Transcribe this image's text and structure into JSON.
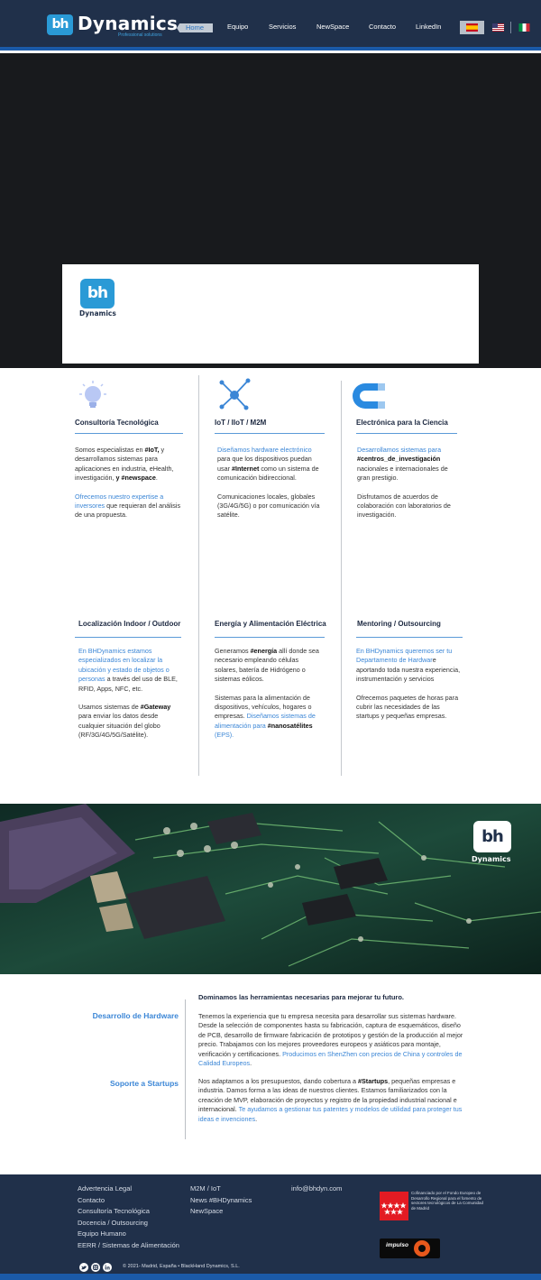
{
  "header": {
    "logo_mark": "bh",
    "logo_text": "Dynamics",
    "logo_tagline": "Professional solutions",
    "nav": [
      "Home",
      "Equipo",
      "Servicios",
      "NewSpace",
      "Contacto",
      "LinkedIn"
    ],
    "languages": [
      "es",
      "en",
      "it"
    ]
  },
  "hero": {
    "logo_mark": "bh",
    "logo_text": "Dynamics"
  },
  "services": [
    {
      "title": "Consultoría Tecnológica",
      "icon": "lightbulb-icon",
      "p1_a": "Somos especialistas en ",
      "p1_b": "#IoT,",
      "p1_c": " y desarrollamos sistemas para aplicaciones en industria, eHealth, investigación,  ",
      "p1_d": "y #newspace",
      "p1_e": ".",
      "p2_a": "Ofrecemos nuestro expertise a inversores",
      "p2_b": " que requieran del análisis de una propuesta."
    },
    {
      "title": "IoT / IIoT / M2M",
      "icon": "network-nodes-icon",
      "p1_a": "Diseñamos  hardware electrónico",
      "p1_b": " para que los dispositivos puedan usar ",
      "p1_c": "#Internet",
      "p1_d": " como un sistema de comunicación bidireccional.",
      "p2": "Comunicaciones locales, globales (3G/4G/5G) o por comunicación vía satélite."
    },
    {
      "title": "Electrónica para la Ciencia",
      "icon": "magnet-icon",
      "p1_a": "Desarrollamos sistemas para ",
      "p1_b": "#centros_de_investigación",
      "p1_c": " nacionales e internacionales de gran prestigio.",
      "p2": "Disfrutamos de acuerdos de colaboración con laboratorios de investigación."
    },
    {
      "title": "Localización Indoor / Outdoor",
      "p1_a": "En BHDynamics estamos especializados en localizar la ubicación y estado de objetos o personas",
      "p1_b": " a través del uso de BLE, RFID, Apps, NFC, etc.",
      "p2_a": "Usamos sistemas de ",
      "p2_b": "#Gateway",
      "p2_c": " para enviar los datos desde cualquier situación del globo (RF/3G/4G/5G/Satélite)."
    },
    {
      "title": "Energía y Alimentación Eléctrica",
      "p1_a": "Generamos ",
      "p1_b": "#energía",
      "p1_c": " allí donde sea necesario empleando células solares, batería de Hidrógeno o sistemas eólicos.",
      "p2_a": "Sistemas para la alimentación de dispositivos, vehículos, hogares o empresas. ",
      "p2_b": "Diseñamos sistemas de alimentación para ",
      "p2_c": "#nanosatélites",
      "p2_d": " (EPS)."
    },
    {
      "title": "Mentoring / Outsourcing",
      "p1_a": "En BHDynamics queremos ser tu Departamento de Hardwar",
      "p1_b": "e aportando toda nuestra experiencia, instrumentación y servicios",
      "p2": "Ofrecemos paquetes de horas para cubrir las necesidades de las startups y pequeñas empresas."
    }
  ],
  "pcb_banner": {
    "logo_mark": "bh",
    "logo_text": "Dynamics"
  },
  "tools": {
    "heading": "Dominamos las herramientas necesarias para mejorar tu futuro.",
    "hw_label": "Desarrollo de Hardware",
    "hw_text_a": "Tenemos la experiencia que tu empresa necesita para desarrollar sus sistemas hardware. Desde la selección de componentes hasta su fabricación, captura de esquemáticos, diseño de PCB, desarrollo de firmware fabricación de prototipos y gestión de la producción al mejor precio.  Trabajamos con los mejores proveedores europeos y asiáticos para montaje, verificación y certificaciones. ",
    "hw_text_b": "Producimos en ShenZhen con precios de China y controles de Calidad Europeos",
    "hw_text_c": ".",
    "st_label": "Soporte a Startups",
    "st_text_a": "Nos adaptamos a los presupuestos, dando cobertura a ",
    "st_text_b": "#Startups",
    "st_text_c": ", pequeñas empresas e industria. Damos forma a las ideas de nuestros clientes. Estamos familiarizados con la creación de MVP, elaboración de proyectos y registro de la propiedad industrial nacional e internacional. ",
    "st_text_d": "Te ayudamos a gestionar tus patentes y modelos de utilidad para proteger tus ideas e invenciones",
    "st_text_e": "."
  },
  "footer": {
    "col1": [
      "Advertencia Legal",
      "Contacto",
      "Consultoría Tecnológica",
      "Docencia / Outsourcing",
      "Equipo Humano",
      "EERR / Sistemas de Alimentación"
    ],
    "col2": [
      "M2M / IoT",
      "News #BHDynamics",
      "NewSpace"
    ],
    "email": "info@bhdyn.com",
    "cm_text": "Cofinanciado por el Fondo Europeo de Desarrollo Regional para el fomento de sectores tecnológicos de La Comunidad de Madrid",
    "impulso": "impulso",
    "copyright": "© 2021- Madrid, España • BlackHand Dynamics, S.L.",
    "social": [
      "twitter-icon",
      "instagram-icon",
      "linkedin-icon"
    ]
  }
}
